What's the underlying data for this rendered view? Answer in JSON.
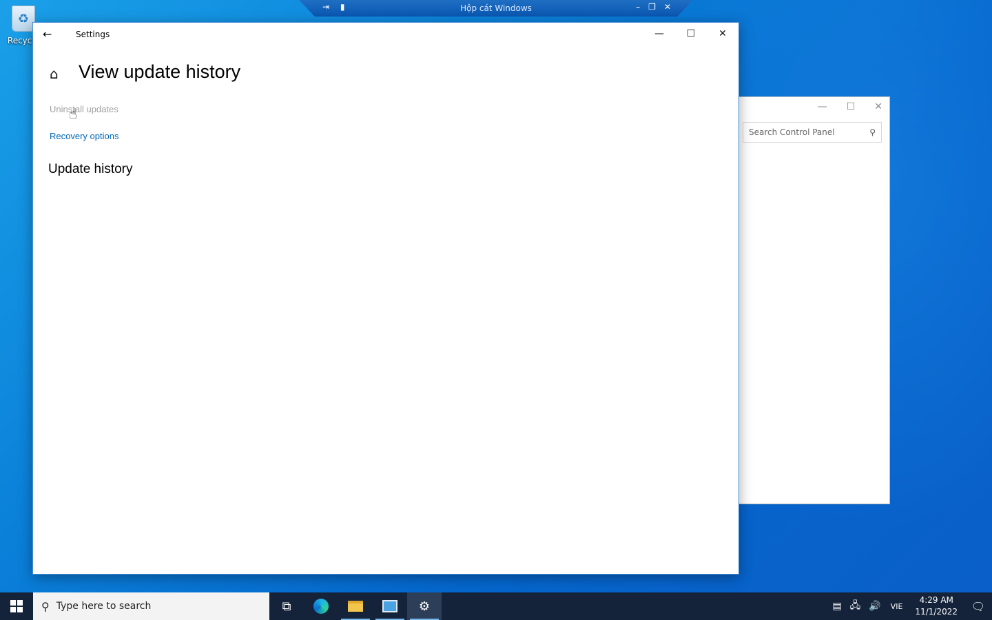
{
  "desktop": {
    "recycle_bin_label": "Recycle"
  },
  "sandbox_bar": {
    "title": "Hộp cát Windows",
    "left_icons": "⇥ ▮",
    "minimize": "–",
    "restore": "❐",
    "close": "✕"
  },
  "control_panel": {
    "search_placeholder": "Search Control Panel",
    "minimize": "—",
    "maximize": "☐",
    "close": "✕"
  },
  "settings": {
    "window_title": "Settings",
    "back": "←",
    "minimize": "—",
    "maximize": "☐",
    "close": "✕",
    "home": "⌂",
    "page_title": "View update history",
    "uninstall_link": "Uninstall updates",
    "recovery_link": "Recovery options",
    "section_title": "Update history"
  },
  "cursor": "☝",
  "taskbar": {
    "search_placeholder": "Type here to search",
    "search_icon": "⚲",
    "task_view": "⧉",
    "settings_icon": "⚙",
    "tray_news": "▤",
    "tray_network": "🖧",
    "tray_volume": "🔊",
    "lang": "VIE",
    "time": "4:29 AM",
    "date": "11/1/2022",
    "notification": "🗨"
  }
}
